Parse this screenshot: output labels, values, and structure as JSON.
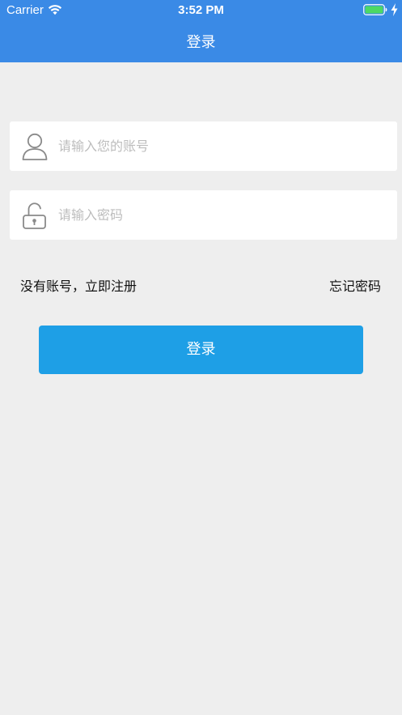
{
  "status_bar": {
    "carrier": "Carrier",
    "time": "3:52 PM",
    "battery_level": 1.0
  },
  "nav": {
    "title": "登录"
  },
  "form": {
    "username": {
      "placeholder": "请输入您的账号",
      "value": "",
      "icon": "user-icon"
    },
    "password": {
      "placeholder": "请输入密码",
      "value": "",
      "icon": "unlock-icon"
    }
  },
  "links": {
    "register": "没有账号，立即注册",
    "forgot": "忘记密码"
  },
  "login_button": {
    "label": "登录"
  },
  "colors": {
    "header": "#3a8ae6",
    "background": "#eeeeee",
    "button": "#1e9fe6",
    "battery": "#4cd964",
    "placeholder": "#bdbdbd",
    "icon": "#8a8a8a"
  }
}
